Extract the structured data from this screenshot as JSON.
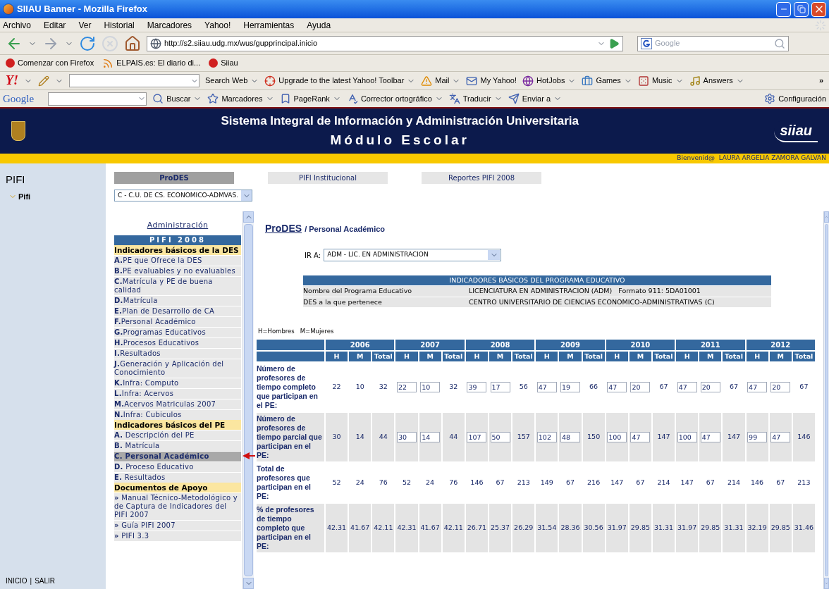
{
  "window": {
    "title": "SIIAU Banner - Mozilla Firefox"
  },
  "menu": [
    "Archivo",
    "Editar",
    "Ver",
    "Historial",
    "Marcadores",
    "Yahoo!",
    "Herramientas",
    "Ayuda"
  ],
  "address": {
    "value": "http://s2.siiau.udg.mx/wus/gupprincipal.inicio"
  },
  "search": {
    "placeholder": "Google"
  },
  "bookmarks": [
    "Comenzar con Firefox",
    "ELPAIS.es: El diario di...",
    "Siiau"
  ],
  "yahoo_toolbar": {
    "logo": "Y!",
    "items": [
      "Search Web",
      "Upgrade to the latest Yahoo! Toolbar",
      "Mail",
      "My Yahoo!",
      "HotJobs",
      "Games",
      "Music",
      "Answers"
    ],
    "more": "»"
  },
  "google_toolbar": {
    "logo": "Google",
    "items": [
      "Buscar",
      "Marcadores",
      "PageRank",
      "Corrector ortográfico",
      "Traducir",
      "Enviar a",
      "Configuración"
    ]
  },
  "header": {
    "title": "Sistema Integral de Información y Administración Universitaria",
    "subtitle": "Módulo Escolar",
    "logo": "siiau"
  },
  "welcome": "Bienvenid@  LAURA ARGELIA ZAMORA GALVAN",
  "sidebar": {
    "title": "PIFI",
    "items": [
      "Pifi"
    ],
    "footer": [
      "INICIO",
      "SALIR"
    ],
    "separator": "|"
  },
  "tabs": [
    {
      "label": "ProDES",
      "selected": true
    },
    {
      "label": "PIFI Institucional",
      "selected": false
    },
    {
      "label": "Reportes PIFI 2008",
      "selected": false
    }
  ],
  "des_select": {
    "value": "C - C.U. DE CS. ECONOMICO-ADMVAS."
  },
  "nav": {
    "link": "Administración",
    "title": "PIFI 2008",
    "groups": [
      {
        "heading": "Indicadores básicos de la DES",
        "items": [
          {
            "label": "**A.**PE que Ofrece la DES",
            "selected": false
          },
          {
            "label": "**B.**PE evaluables y no evaluables",
            "selected": false
          },
          {
            "label": "**C.**Matrícula y PE de buena calidad",
            "selected": false
          },
          {
            "label": "**D.**Matrícula",
            "selected": false
          },
          {
            "label": "**E.**Plan de Desarrollo de CA",
            "selected": false
          },
          {
            "label": "**F.**Personal Académico",
            "selected": false
          },
          {
            "label": "**G.**Programas Educativos",
            "selected": false
          },
          {
            "label": "**H.**Procesos Educativos",
            "selected": false
          },
          {
            "label": "**I.**Resultados",
            "selected": false
          },
          {
            "label": "**J.**Generación y Aplicación del Conocimiento",
            "selected": false
          },
          {
            "label": "**K.**Infra: Computo",
            "selected": false
          },
          {
            "label": "**L.**Infra: Acervos",
            "selected": false
          },
          {
            "label": "**M.**Acervos Matriculas 2007",
            "selected": false
          },
          {
            "label": "**N.**Infra: Cubiculos",
            "selected": false
          }
        ]
      },
      {
        "heading": "Indicadores básicos del PE",
        "items": [
          {
            "label": "**A.** Descripción del PE",
            "selected": false
          },
          {
            "label": "**B.** Matrícula",
            "selected": false
          },
          {
            "label": "**C. Personal Académico**",
            "selected": true
          },
          {
            "label": "**D.** Proceso Educativo",
            "selected": false
          },
          {
            "label": "**E.** Resultados",
            "selected": false
          }
        ]
      },
      {
        "heading": "Documentos de Apoyo",
        "items": [
          {
            "label": "**»** Manual Técnico-Metodológico y de Captura de Indicadores del PIFI 2007",
            "selected": false
          },
          {
            "label": "**»** Guía PIFI 2007",
            "selected": false
          },
          {
            "label": "**»** PIFI 3.3",
            "selected": false
          }
        ]
      }
    ]
  },
  "content": {
    "breadcrumb_link": "ProDES",
    "breadcrumb": "/ Personal Académico",
    "goto": {
      "label": "IR A:",
      "value": "ADM - LIC. EN ADMINISTRACION"
    },
    "info": {
      "title": "INDICADORES BÁSICOS DEL PROGRAMA EDUCATIVO",
      "rows": [
        {
          "label": "Nombre del Programa Educativo",
          "value": "LICENCIATURA EN ADMINISTRACION (ADM)   Formato 911: 5DA01001"
        },
        {
          "label": "DES a la que pertenece",
          "value": "CENTRO UNIVERSITARIO DE CIENCIAS ECONOMICO-ADMINISTRATIVAS (C)"
        }
      ]
    },
    "legend": [
      "H=Hombres",
      "M=Mujeres"
    ],
    "table": {
      "years": [
        {
          "year": "2006",
          "columns": [
            "H",
            "M",
            "Total"
          ]
        },
        {
          "year": "2007",
          "columns": [
            "H",
            "M",
            "Total"
          ]
        },
        {
          "year": "2008",
          "columns": [
            "H",
            "M",
            "Total"
          ]
        },
        {
          "year": "2009",
          "columns": [
            "H",
            "M",
            "Total"
          ]
        },
        {
          "year": "2010",
          "columns": [
            "H",
            "M",
            "Total"
          ]
        },
        {
          "year": "2011",
          "columns": [
            "H",
            "M",
            "Total"
          ]
        },
        {
          "year": "2012",
          "columns": [
            "H",
            "M",
            "Total"
          ]
        }
      ],
      "rows": [
        {
          "label": "Número de profesores de tiempo completo que participan en el PE:",
          "cells": [
            {
              "text": "22",
              "kind": "text"
            },
            {
              "text": "10",
              "kind": "text"
            },
            {
              "text": "32",
              "kind": "text"
            },
            {
              "text": "22",
              "kind": "input"
            },
            {
              "text": "10",
              "kind": "input"
            },
            {
              "text": "32",
              "kind": "text"
            },
            {
              "text": "39",
              "kind": "input"
            },
            {
              "text": "17",
              "kind": "input"
            },
            {
              "text": "56",
              "kind": "text"
            },
            {
              "text": "47",
              "kind": "input"
            },
            {
              "text": "19",
              "kind": "input"
            },
            {
              "text": "66",
              "kind": "text"
            },
            {
              "text": "47",
              "kind": "input"
            },
            {
              "text": "20",
              "kind": "input"
            },
            {
              "text": "67",
              "kind": "text"
            },
            {
              "text": "47",
              "kind": "input"
            },
            {
              "text": "20",
              "kind": "input"
            },
            {
              "text": "67",
              "kind": "text"
            },
            {
              "text": "47",
              "kind": "input"
            },
            {
              "text": "20",
              "kind": "input"
            },
            {
              "text": "67",
              "kind": "text"
            }
          ]
        },
        {
          "label": "Número de profesores de tiempo parcial que participan en el PE:",
          "cells": [
            {
              "text": "30",
              "kind": "text"
            },
            {
              "text": "14",
              "kind": "text"
            },
            {
              "text": "44",
              "kind": "text"
            },
            {
              "text": "30",
              "kind": "input"
            },
            {
              "text": "14",
              "kind": "input"
            },
            {
              "text": "44",
              "kind": "text"
            },
            {
              "text": "107",
              "kind": "input"
            },
            {
              "text": "50",
              "kind": "input"
            },
            {
              "text": "157",
              "kind": "text"
            },
            {
              "text": "102",
              "kind": "input"
            },
            {
              "text": "48",
              "kind": "input"
            },
            {
              "text": "150",
              "kind": "text"
            },
            {
              "text": "100",
              "kind": "input"
            },
            {
              "text": "47",
              "kind": "input"
            },
            {
              "text": "147",
              "kind": "text"
            },
            {
              "text": "100",
              "kind": "input"
            },
            {
              "text": "47",
              "kind": "input"
            },
            {
              "text": "147",
              "kind": "text"
            },
            {
              "text": "99",
              "kind": "input"
            },
            {
              "text": "47",
              "kind": "input"
            },
            {
              "text": "146",
              "kind": "text"
            }
          ]
        },
        {
          "label": "Total de profesores que participan en el PE:",
          "cells": [
            {
              "text": "52",
              "kind": "text"
            },
            {
              "text": "24",
              "kind": "text"
            },
            {
              "text": "76",
              "kind": "text"
            },
            {
              "text": "52",
              "kind": "text"
            },
            {
              "text": "24",
              "kind": "text"
            },
            {
              "text": "76",
              "kind": "text"
            },
            {
              "text": "146",
              "kind": "text"
            },
            {
              "text": "67",
              "kind": "text"
            },
            {
              "text": "213",
              "kind": "text"
            },
            {
              "text": "149",
              "kind": "text"
            },
            {
              "text": "67",
              "kind": "text"
            },
            {
              "text": "216",
              "kind": "text"
            },
            {
              "text": "147",
              "kind": "text"
            },
            {
              "text": "67",
              "kind": "text"
            },
            {
              "text": "214",
              "kind": "text"
            },
            {
              "text": "147",
              "kind": "text"
            },
            {
              "text": "67",
              "kind": "text"
            },
            {
              "text": "214",
              "kind": "text"
            },
            {
              "text": "146",
              "kind": "text"
            },
            {
              "text": "67",
              "kind": "text"
            },
            {
              "text": "213",
              "kind": "text"
            }
          ]
        },
        {
          "label": "% de profesores de tiempo completo que participan en el PE:",
          "cells": [
            {
              "text": "42.31",
              "kind": "text"
            },
            {
              "text": "41.67",
              "kind": "text"
            },
            {
              "text": "42.11",
              "kind": "text"
            },
            {
              "text": "42.31",
              "kind": "text"
            },
            {
              "text": "41.67",
              "kind": "text"
            },
            {
              "text": "42.11",
              "kind": "text"
            },
            {
              "text": "26.71",
              "kind": "text"
            },
            {
              "text": "25.37",
              "kind": "text"
            },
            {
              "text": "26.29",
              "kind": "text"
            },
            {
              "text": "31.54",
              "kind": "text"
            },
            {
              "text": "28.36",
              "kind": "text"
            },
            {
              "text": "30.56",
              "kind": "text"
            },
            {
              "text": "31.97",
              "kind": "text"
            },
            {
              "text": "29.85",
              "kind": "text"
            },
            {
              "text": "31.31",
              "kind": "text"
            },
            {
              "text": "31.97",
              "kind": "text"
            },
            {
              "text": "29.85",
              "kind": "text"
            },
            {
              "text": "31.31",
              "kind": "text"
            },
            {
              "text": "32.19",
              "kind": "text"
            },
            {
              "text": "29.85",
              "kind": "text"
            },
            {
              "text": "31.46",
              "kind": "text"
            }
          ]
        }
      ]
    }
  }
}
